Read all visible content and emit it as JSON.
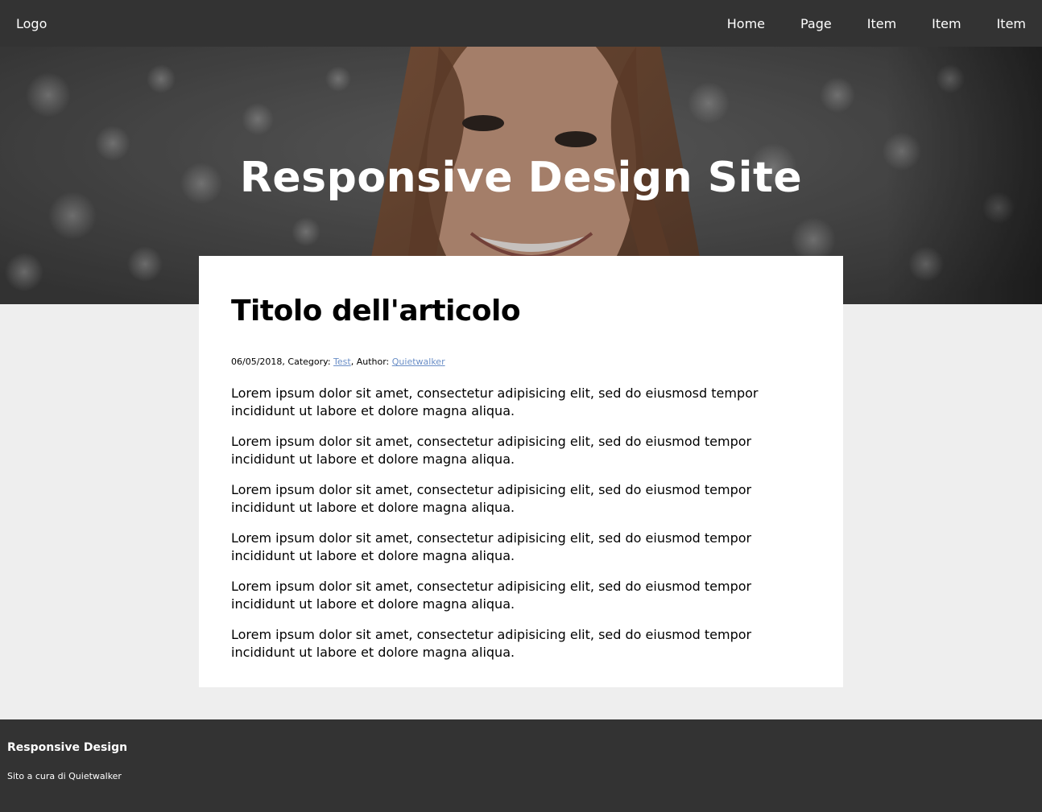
{
  "header": {
    "logo": "Logo",
    "nav": [
      "Home",
      "Page",
      "Item",
      "Item",
      "Item"
    ]
  },
  "hero": {
    "title": "Responsive Design Site"
  },
  "article": {
    "title": "Titolo dell'articolo",
    "meta": {
      "date_prefix": "06/05/2018, Category: ",
      "category": "Test",
      "author_prefix": ", Author: ",
      "author": "Quietwalker"
    },
    "paragraphs": [
      "Lorem ipsum dolor sit amet, consectetur adipisicing elit, sed do eiusmosd tempor incididunt ut labore et dolore magna aliqua.",
      "Lorem ipsum dolor sit amet, consectetur adipisicing elit, sed do eiusmod tempor incididunt ut labore et dolore magna aliqua.",
      "Lorem ipsum dolor sit amet, consectetur adipisicing elit, sed do eiusmod tempor incididunt ut labore et dolore magna aliqua.",
      "Lorem ipsum dolor sit amet, consectetur adipisicing elit, sed do eiusmod tempor incididunt ut labore et dolore magna aliqua.",
      "Lorem ipsum dolor sit amet, consectetur adipisicing elit, sed do eiusmod tempor incididunt ut labore et dolore magna aliqua.",
      "Lorem ipsum dolor sit amet, consectetur adipisicing elit, sed do eiusmod tempor incididunt ut labore et dolore magna aliqua."
    ]
  },
  "footer": {
    "title": "Responsive Design",
    "credit": "Sito a cura di Quietwalker"
  },
  "colors": {
    "header_bg": "#333333",
    "page_bg": "#eeeeee",
    "link": "#6b8fc7"
  }
}
